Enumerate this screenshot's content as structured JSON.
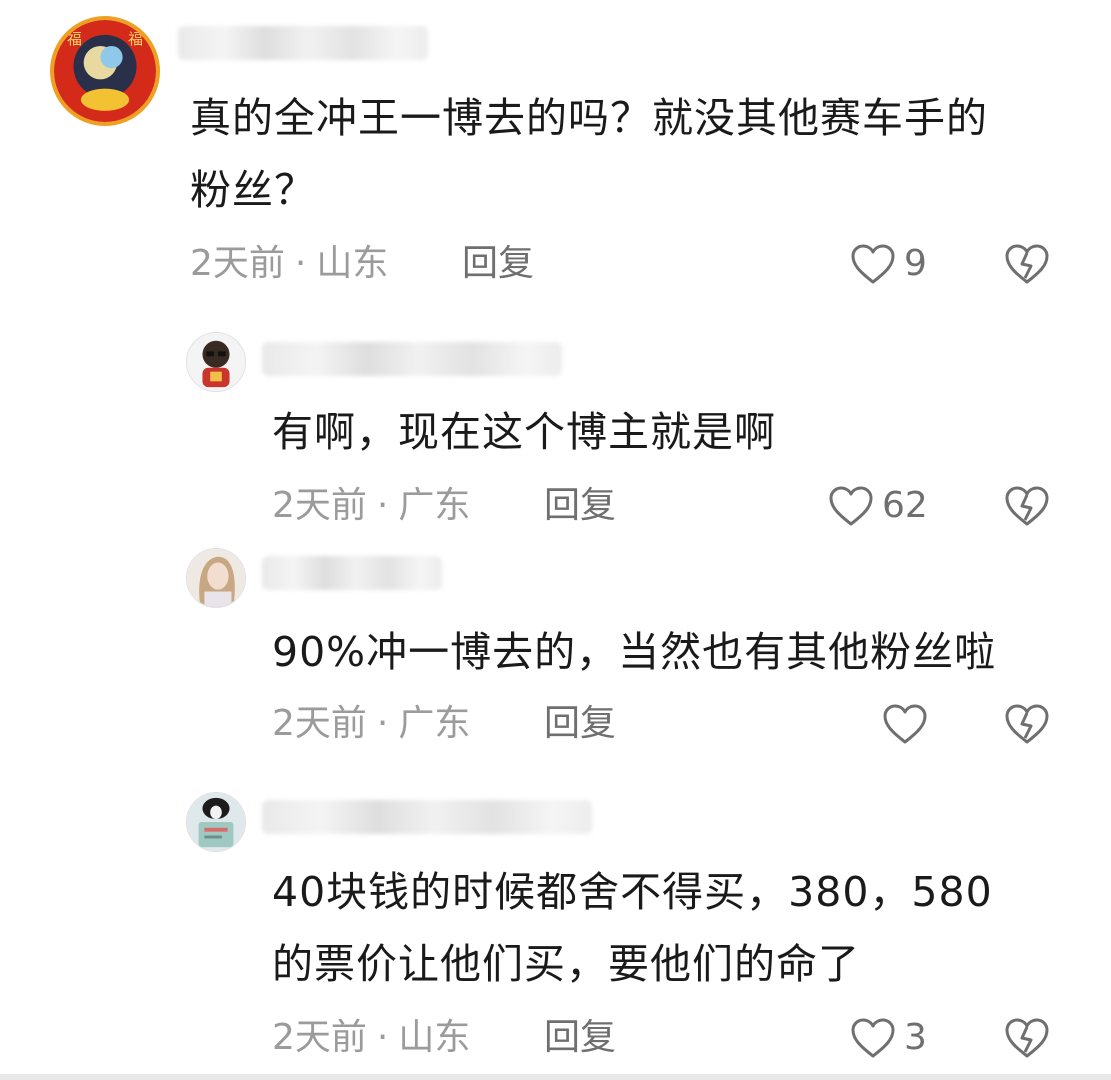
{
  "comments": [
    {
      "text_lines": [
        "真的全冲王一博去的吗？就没其他赛车手的",
        "粉丝？"
      ],
      "time": "2天前",
      "location": "山东",
      "reply_label": "回复",
      "likes": "9"
    },
    {
      "text_lines": [
        "有啊，现在这个博主就是啊"
      ],
      "time": "2天前",
      "location": "广东",
      "reply_label": "回复",
      "likes": "62"
    },
    {
      "text_lines": [
        "90%冲一博去的，当然也有其他粉丝啦"
      ],
      "time": "2天前",
      "location": "广东",
      "reply_label": "回复",
      "likes": ""
    },
    {
      "text_lines": [
        "40块钱的时候都舍不得买，380，580",
        "的票价让他们买，要他们的命了"
      ],
      "time": "2天前",
      "location": "山东",
      "reply_label": "回复",
      "likes": "3"
    }
  ],
  "separator": "·",
  "icons": {
    "like": "heart-outline-icon",
    "dislike": "broken-heart-icon"
  },
  "colors": {
    "text": "#1a1a1a",
    "meta": "#9b9b9b",
    "icon": "#6f6f6f"
  }
}
